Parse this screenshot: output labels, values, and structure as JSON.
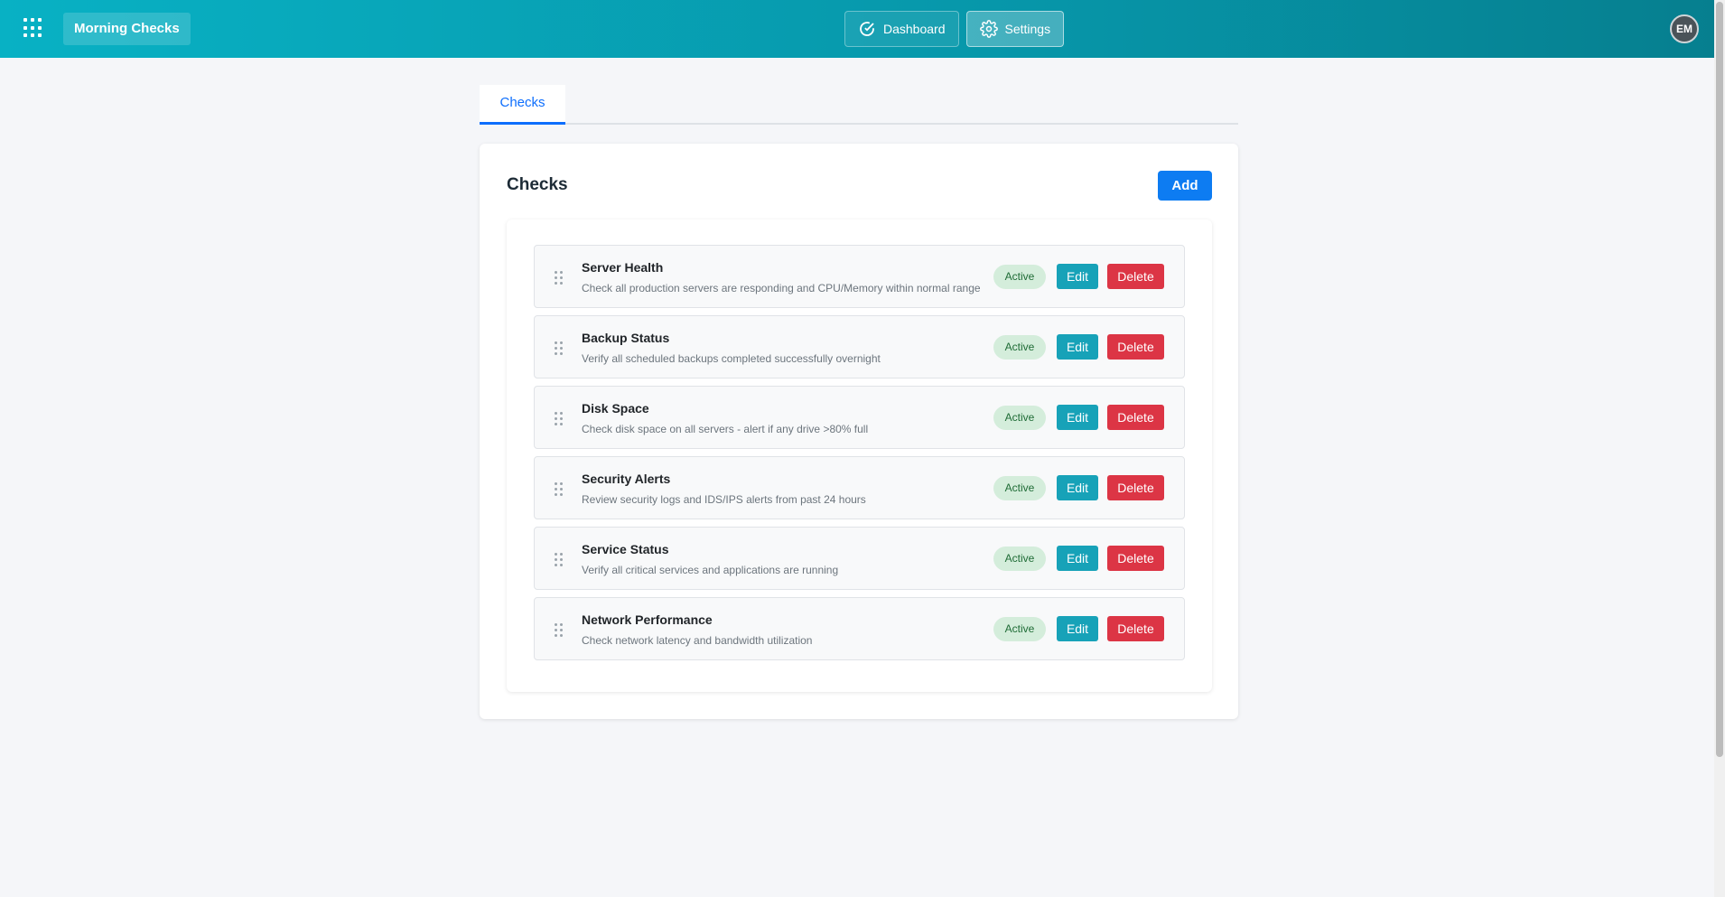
{
  "header": {
    "app_name": "Morning Checks",
    "nav": [
      {
        "label": "Dashboard",
        "icon": "check-circle-icon",
        "active": false
      },
      {
        "label": "Settings",
        "icon": "gear-icon",
        "active": true
      }
    ],
    "avatar_initials": "EM"
  },
  "tabs": [
    {
      "label": "Checks",
      "active": true
    }
  ],
  "card": {
    "title": "Checks",
    "add_label": "Add"
  },
  "checks": [
    {
      "title": "Server Health",
      "description": "Check all production servers are responding and CPU/Memory within normal range",
      "status": "Active",
      "edit_label": "Edit",
      "delete_label": "Delete"
    },
    {
      "title": "Backup Status",
      "description": "Verify all scheduled backups completed successfully overnight",
      "status": "Active",
      "edit_label": "Edit",
      "delete_label": "Delete"
    },
    {
      "title": "Disk Space",
      "description": "Check disk space on all servers - alert if any drive >80% full",
      "status": "Active",
      "edit_label": "Edit",
      "delete_label": "Delete"
    },
    {
      "title": "Security Alerts",
      "description": "Review security logs and IDS/IPS alerts from past 24 hours",
      "status": "Active",
      "edit_label": "Edit",
      "delete_label": "Delete"
    },
    {
      "title": "Service Status",
      "description": "Verify all critical services and applications are running",
      "status": "Active",
      "edit_label": "Edit",
      "delete_label": "Delete"
    },
    {
      "title": "Network Performance",
      "description": "Check network latency and bandwidth utilization",
      "status": "Active",
      "edit_label": "Edit",
      "delete_label": "Delete"
    }
  ],
  "colors": {
    "header_start": "#08b1c4",
    "header_end": "#067f8f",
    "primary": "#0d7cf2",
    "info": "#17a2b8",
    "danger": "#dc3545",
    "success_bg": "#d4eddb"
  }
}
